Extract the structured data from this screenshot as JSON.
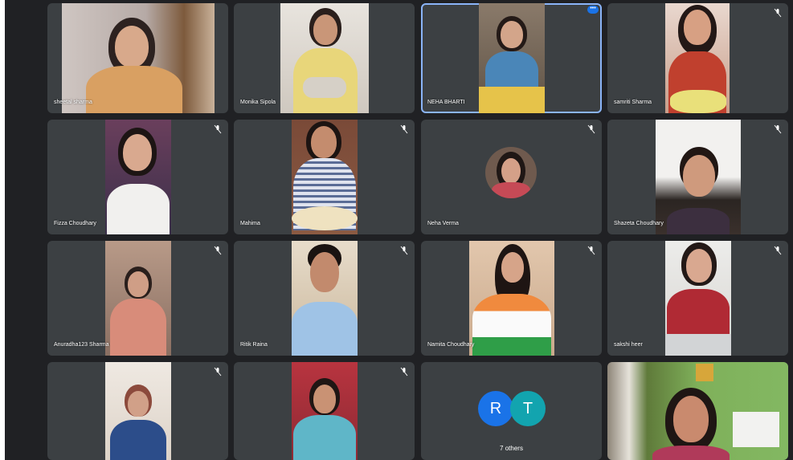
{
  "colors": {
    "background": "#202124",
    "tile": "#3c4043",
    "active_outline": "#8ab4f8",
    "avatar_blue": "#1a73e8",
    "avatar_teal": "#12a4af"
  },
  "participants": [
    {
      "name": "sheetal sharma",
      "muted": false
    },
    {
      "name": "Monika Sipola",
      "muted": false
    },
    {
      "name": "NEHA BHARTI",
      "muted": false,
      "active": true
    },
    {
      "name": "samriti Sharma",
      "muted": true
    },
    {
      "name": "Fizza Choudhary",
      "muted": true
    },
    {
      "name": "Mahima",
      "muted": true
    },
    {
      "name": "Neha Verma",
      "muted": true
    },
    {
      "name": "Shazeta Choudhary",
      "muted": true
    },
    {
      "name": "Anuradha123 Sharma",
      "muted": true
    },
    {
      "name": "Ritik Raina",
      "muted": true
    },
    {
      "name": "Namita Choudhary",
      "muted": true
    },
    {
      "name": "sakshi heer",
      "muted": true
    },
    {
      "name": "",
      "muted": true
    },
    {
      "name": "",
      "muted": true
    },
    {
      "name": "",
      "muted": false
    }
  ],
  "others_tile": {
    "initials": [
      "R",
      "T"
    ],
    "label": "7 others"
  }
}
